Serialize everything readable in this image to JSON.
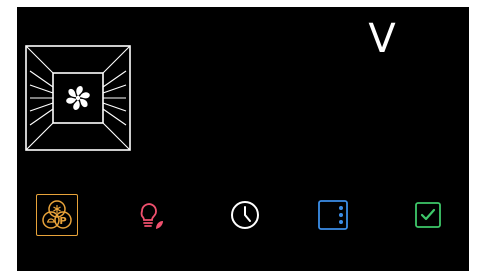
{
  "status": {
    "mode_letter": "V"
  },
  "oven": {
    "icon": "oven-fan-icon",
    "color": "#ffffff"
  },
  "toolbar": {
    "buttons": [
      {
        "icon": "fan-pizza-program-icon",
        "color": "#e8a33a",
        "selected": true
      },
      {
        "icon": "eco-lamp-icon",
        "color": "#f0506e",
        "selected": false
      },
      {
        "icon": "clock-icon",
        "color": "#ffffff",
        "selected": false
      },
      {
        "icon": "door-menu-icon",
        "color": "#3b8ee8",
        "selected": false
      },
      {
        "icon": "checkbox-confirm-icon",
        "color": "#3ec86a",
        "selected": false
      }
    ]
  }
}
